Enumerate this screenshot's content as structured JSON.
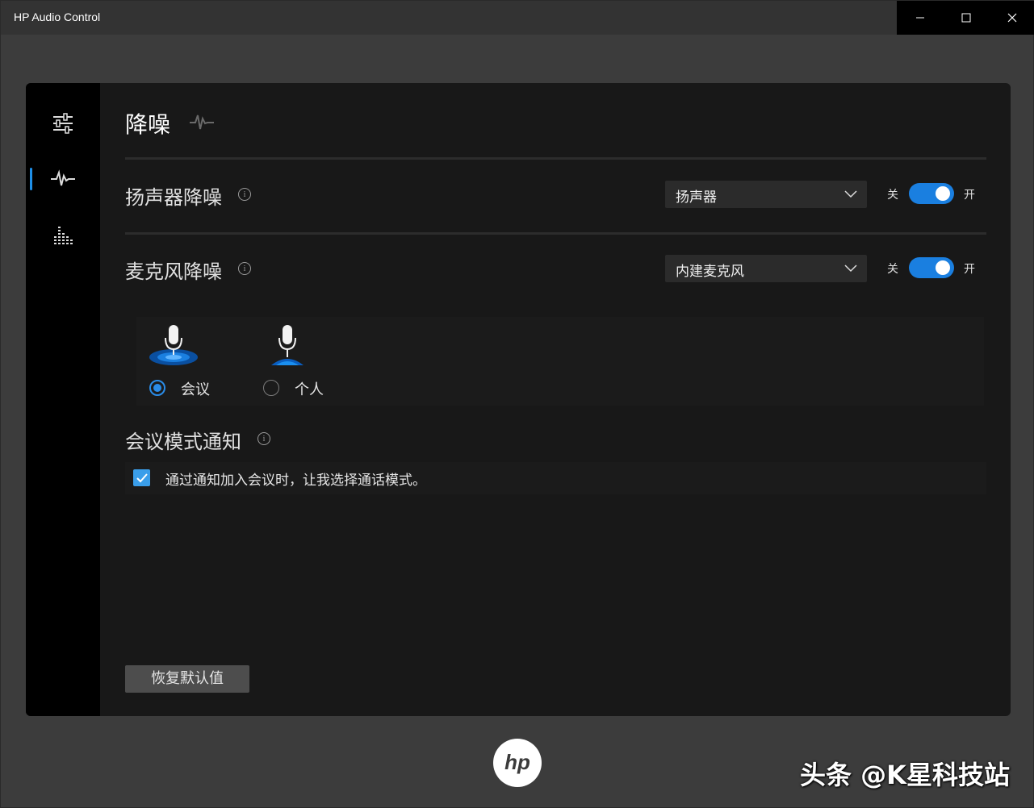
{
  "window": {
    "title": "HP Audio Control",
    "controls": {
      "minimize": "—",
      "maximize": "☐",
      "close": "✕"
    }
  },
  "sidebar": {
    "items": [
      {
        "name": "settings",
        "icon": "sliders-icon",
        "active": false
      },
      {
        "name": "noise-reduction",
        "icon": "waveform-icon",
        "active": true
      },
      {
        "name": "equalizer",
        "icon": "equalizer-icon",
        "active": false
      }
    ]
  },
  "page": {
    "title": "降噪",
    "speaker": {
      "label": "扬声器降噪",
      "device": "扬声器",
      "toggle_off": "关",
      "toggle_on": "开",
      "enabled": true
    },
    "mic": {
      "label": "麦克风降噪",
      "device": "内建麦克风",
      "toggle_off": "关",
      "toggle_on": "开",
      "enabled": true,
      "modes": [
        {
          "label": "会议",
          "selected": true
        },
        {
          "label": "个人",
          "selected": false
        }
      ]
    },
    "notify": {
      "label": "会议模式通知",
      "checkbox_text": "通过通知加入会议时，让我选择通话模式。",
      "checked": true
    },
    "reset_label": "恢复默认值"
  },
  "footer": {
    "logo": "hp",
    "watermark": "头条 @K星科技站"
  },
  "colors": {
    "accent": "#1a7fe0",
    "panel": "#181818",
    "sidebar": "#000000",
    "background": "#3c3c3c"
  }
}
